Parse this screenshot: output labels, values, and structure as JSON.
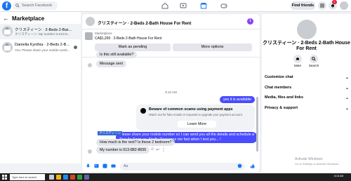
{
  "topbar": {
    "search_placeholder": "Search Facebook",
    "find_friends": "Find friends",
    "notification_count": "1"
  },
  "sidebar": {
    "title": "Marketplace",
    "conversations": [
      {
        "name": "クリスティーン · 2-Beds 2-Bath H...",
        "preview": "クリスティーン: My number is 613-8...",
        "time": "1m"
      },
      {
        "name": "Daniella Kynthia · 2-Beds 2-Bath H...",
        "preview": "You: Please share your mobile numb...",
        "time": "1m"
      }
    ]
  },
  "chat": {
    "title": "クリスティーン · 2-Beds 2-Bath House For Rent",
    "listing_label": "Marketplace",
    "listing_price": "CA$1,200 · 2-Beds 2-Bath House For Rent",
    "mark_pending": "Mark as pending",
    "more_options": "More options",
    "messages": {
      "m1": "Is this still available?",
      "m2": "Message sent",
      "timestamp": "8:10 AM",
      "m3": "yes it is available",
      "m4_line1": "Please share your mobile number so I can send you all the details and schedule a",
      "m4_line2": "Tour As Soon as. Kindly Response me fast when I text you... !",
      "sender_name": "クリスティーン",
      "m5": "How much is the rent? Is these 2 bedroom?",
      "m6": "My number is 613-882-8655"
    },
    "scam_card": {
      "title": "Beware of common scams using payment apps",
      "body": "Watch out for fake emails or requests to upgrade your payment account.",
      "learn_more": "Learn More"
    },
    "composer_placeholder": "Aa"
  },
  "right_panel": {
    "name_line1": "クリスティーン · 2-Beds 2-Bath House",
    "name_line2": "For Rent",
    "mute": "Mute",
    "search": "Search",
    "rows": [
      "Customize chat",
      "Chat members",
      "Media, files and links",
      "Privacy & support"
    ]
  },
  "watermark": {
    "line1": "Activate Windows",
    "line2": "Go to Settings to activate Windows."
  },
  "taskbar": {
    "search_text": "Type here to search",
    "time": "8:15 AM"
  },
  "colors": {
    "brand": "#1877f2",
    "outgoing_bubble": "#4a4cff",
    "info_icon": "#8a3ffc",
    "notification": "#e41e3f"
  }
}
